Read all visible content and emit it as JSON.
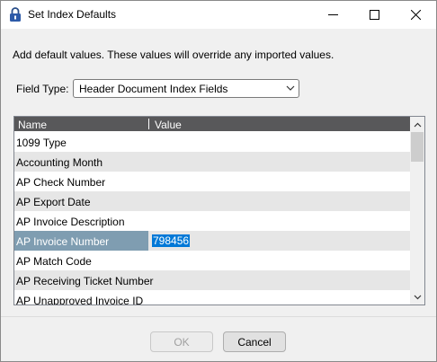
{
  "window": {
    "title": "Set Index Defaults",
    "icon": "lock-icon"
  },
  "description": "Add default values. These values will override any imported values.",
  "field_type": {
    "label": "Field Type:",
    "value": "Header Document Index Fields"
  },
  "grid": {
    "headers": [
      "Name",
      "Value"
    ],
    "rows": [
      {
        "name": "1099 Type",
        "value": ""
      },
      {
        "name": "Accounting Month",
        "value": ""
      },
      {
        "name": "AP Check Number",
        "value": ""
      },
      {
        "name": "AP Export Date",
        "value": ""
      },
      {
        "name": "AP Invoice Description",
        "value": ""
      },
      {
        "name": "AP Invoice Number",
        "value": "798456"
      },
      {
        "name": "AP Match Code",
        "value": ""
      },
      {
        "name": "AP Receiving Ticket Number",
        "value": ""
      },
      {
        "name": "AP Unapproved Invoice ID",
        "value": ""
      }
    ]
  },
  "buttons": {
    "ok": "OK",
    "cancel": "Cancel"
  }
}
